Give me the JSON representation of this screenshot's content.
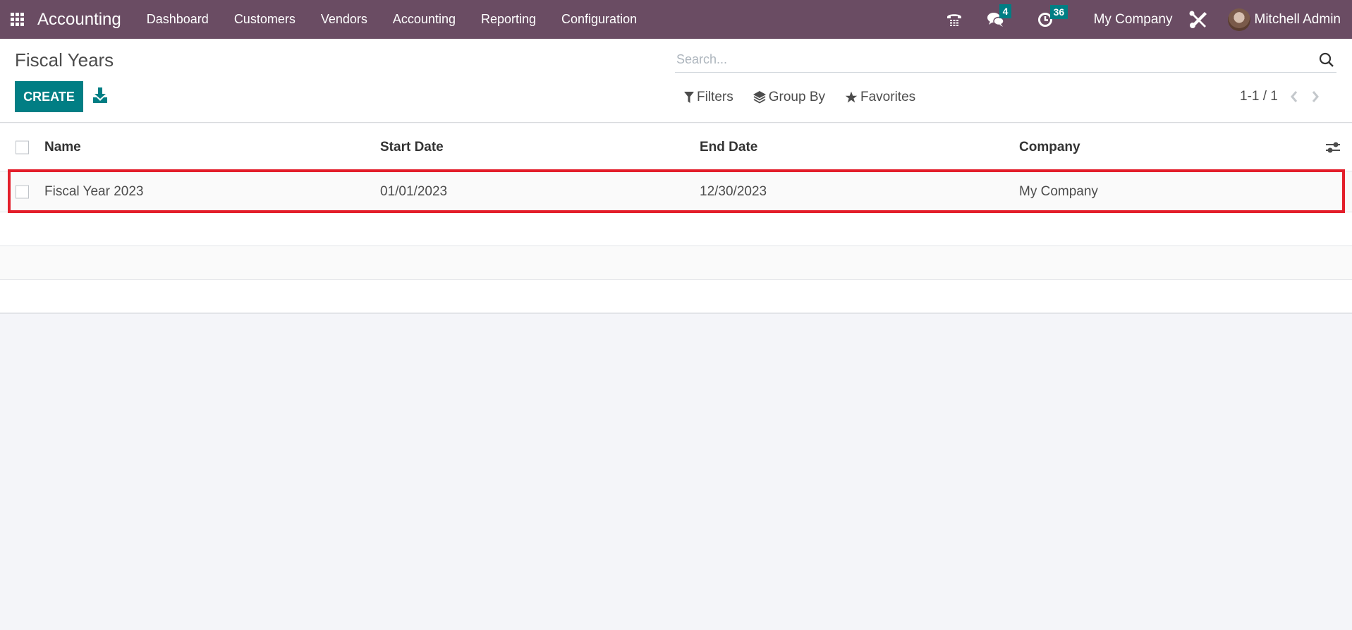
{
  "navbar": {
    "app_name": "Accounting",
    "menu": [
      "Dashboard",
      "Customers",
      "Vendors",
      "Accounting",
      "Reporting",
      "Configuration"
    ],
    "icons": {
      "phone": "phone-icon",
      "messages": "chat-icon",
      "activities": "clock-icon",
      "debug": "tools-icon"
    },
    "messages_count": "4",
    "activities_count": "36",
    "company": "My Company",
    "user": "Mitchell Admin"
  },
  "control_panel": {
    "title": "Fiscal Years",
    "create_label": "CREATE",
    "search_placeholder": "Search...",
    "filters_label": "Filters",
    "group_by_label": "Group By",
    "favorites_label": "Favorites",
    "pager": "1-1 / 1"
  },
  "list": {
    "columns": [
      "Name",
      "Start Date",
      "End Date",
      "Company"
    ],
    "rows": [
      {
        "name": "Fiscal Year 2023",
        "start_date": "01/01/2023",
        "end_date": "12/30/2023",
        "company": "My Company"
      }
    ]
  },
  "colors": {
    "navbar": "#6a4c63",
    "primary": "#017e84",
    "highlight": "#e31e2a"
  }
}
